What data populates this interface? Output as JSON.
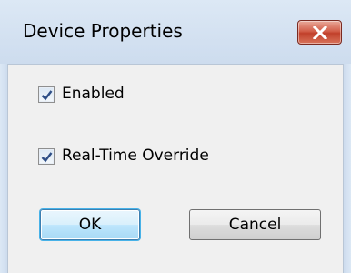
{
  "window": {
    "title": "Device Properties",
    "close_icon": "close-x-icon"
  },
  "options": {
    "enabled": {
      "label": "Enabled",
      "checked": true
    },
    "realtime_override": {
      "label": "Real-Time Override",
      "checked": true
    }
  },
  "buttons": {
    "ok_label": "OK",
    "cancel_label": "Cancel"
  },
  "colors": {
    "close_button": "#c7452f",
    "check_mark": "#2e4e86"
  }
}
